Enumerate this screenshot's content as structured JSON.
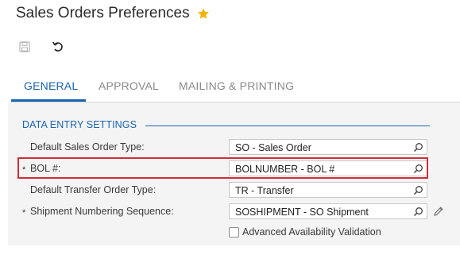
{
  "header": {
    "title": "Sales Orders Preferences"
  },
  "toolbar": {
    "save_icon": "save-icon",
    "undo_icon": "undo-icon"
  },
  "tabs": [
    {
      "label": "GENERAL",
      "active": true
    },
    {
      "label": "APPROVAL",
      "active": false
    },
    {
      "label": "MAILING & PRINTING",
      "active": false
    }
  ],
  "section": {
    "title": "DATA ENTRY SETTINGS",
    "rows": [
      {
        "label": "Default Sales Order Type:",
        "required": false,
        "value": "SO - Sales Order"
      },
      {
        "label": "BOL #:",
        "required": true,
        "value": "BOLNUMBER - BOL #"
      },
      {
        "label": "Default Transfer Order Type:",
        "required": false,
        "value": "TR - Transfer"
      },
      {
        "label": "Shipment Numbering Sequence:",
        "required": true,
        "value": "SOSHIPMENT - SO Shipment"
      }
    ],
    "required_marker": "*",
    "checkbox": {
      "label": "Advanced Availability Validation",
      "checked": false
    }
  },
  "colors": {
    "accent": "#1a64b4",
    "highlight": "#d22d3a",
    "star": "#f2b300"
  }
}
